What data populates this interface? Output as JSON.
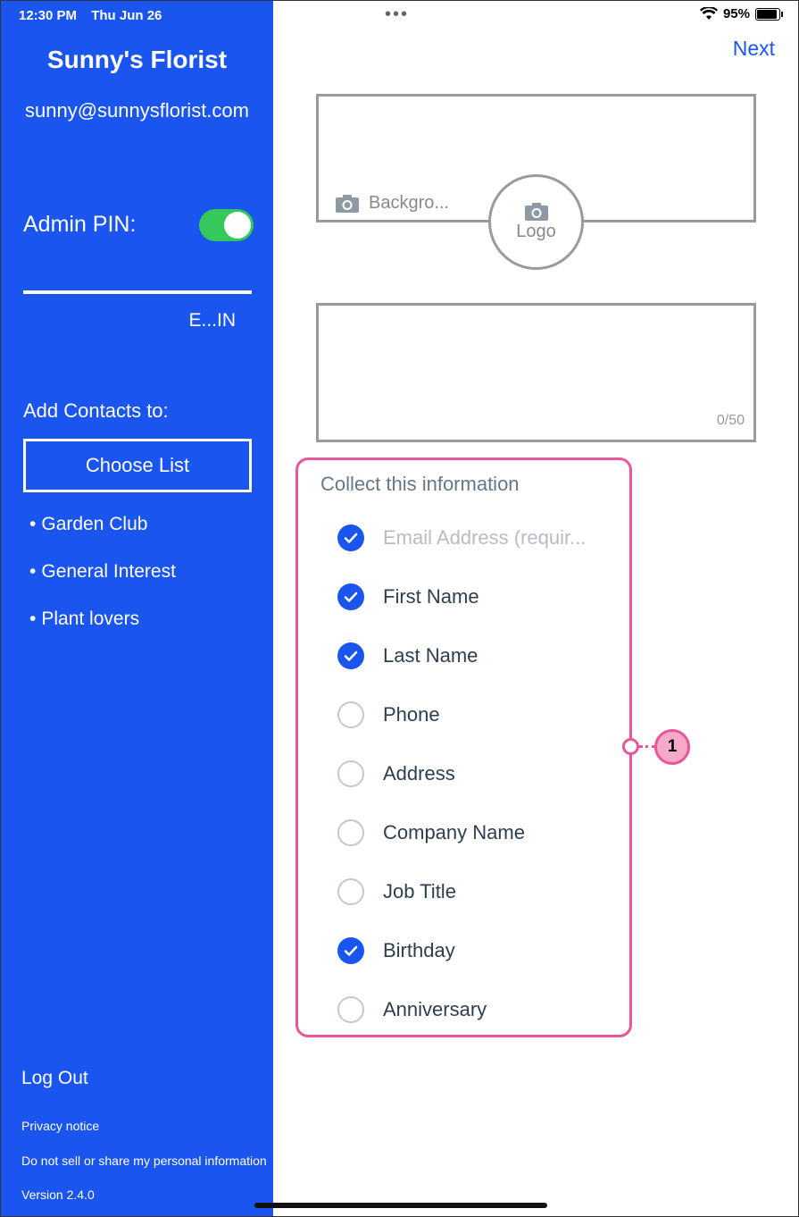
{
  "status_bar": {
    "time": "12:30 PM",
    "date": "Thu Jun 26",
    "battery": "95%"
  },
  "sidebar": {
    "business_name": "Sunny's Florist",
    "email": "sunny@sunnysflorist.com",
    "admin_pin_label": "Admin PIN:",
    "admin_pin_enabled": true,
    "pin_edit_label": "E...IN",
    "add_contacts_label": "Add Contacts to:",
    "choose_list_label": "Choose List",
    "lists": [
      {
        "bullet": "•",
        "name": "Garden Club"
      },
      {
        "bullet": "•",
        "name": "General Interest"
      },
      {
        "bullet": "•",
        "name": "Plant lovers"
      }
    ],
    "logout_label": "Log Out",
    "privacy_label": "Privacy notice",
    "do_not_sell_label": "Do not sell or share my personal information",
    "version_label": "Version 2.4.0"
  },
  "main": {
    "next_label": "Next",
    "background_label": "Backgro...",
    "logo_label": "Logo",
    "char_count": "0/50",
    "collect_title": "Collect this information",
    "fields": [
      {
        "label": "Email Address (requir...",
        "checked": true,
        "disabled": true
      },
      {
        "label": "First Name",
        "checked": true,
        "disabled": false
      },
      {
        "label": "Last Name",
        "checked": true,
        "disabled": false
      },
      {
        "label": "Phone",
        "checked": false,
        "disabled": false
      },
      {
        "label": "Address",
        "checked": false,
        "disabled": false
      },
      {
        "label": "Company Name",
        "checked": false,
        "disabled": false
      },
      {
        "label": "Job Title",
        "checked": false,
        "disabled": false
      },
      {
        "label": "Birthday",
        "checked": true,
        "disabled": false
      },
      {
        "label": "Anniversary",
        "checked": false,
        "disabled": false
      }
    ],
    "callout_number": "1"
  },
  "colors": {
    "sidebar_bg": "#1b55ef",
    "accent": "#1b55ef",
    "toggle_on": "#34c759",
    "callout": "#e9579a"
  }
}
